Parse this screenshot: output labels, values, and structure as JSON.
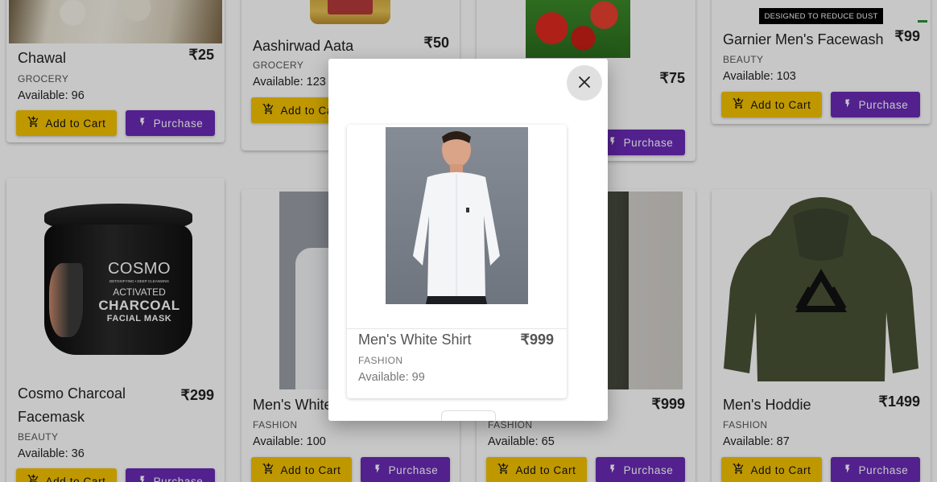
{
  "currency": "₹",
  "button_labels": {
    "cart": "Add to Cart",
    "buy": "Purchase"
  },
  "products": [
    {
      "name": "Chawal",
      "price": "₹25",
      "category": "GROCERY",
      "available": "Available: 96"
    },
    {
      "name": "Aashirwad Aata",
      "price": "₹50",
      "category": "GROCERY",
      "available": "Available: 123"
    },
    {
      "name": "",
      "price": "₹75",
      "category": "",
      "available": ""
    },
    {
      "name": "Garnier Men's Facewash",
      "price": "₹99",
      "category": "BEAUTY",
      "available": "Available: 103",
      "banner_text": "DESIGNED TO REDUCE DUST"
    },
    {
      "name": "Cosmo Charcoal Facemask",
      "price": "₹299",
      "category": "BEAUTY",
      "available": "Available: 36",
      "label_lines": [
        "COSMO",
        "DETOXIFYING • DEEP CLEANSING",
        "ACTIVATED",
        "CHARCOAL",
        "FACIAL MASK"
      ]
    },
    {
      "name": "Men's White Shirt",
      "price": "",
      "category": "FASHION",
      "available": "Available: 100"
    },
    {
      "name": "",
      "price": "₹999",
      "category": "FASHION",
      "available": "Available: 65"
    },
    {
      "name": "Men's Hoddie",
      "price": "₹1499",
      "category": "FASHION",
      "available": "Available: 87"
    }
  ],
  "modal": {
    "name": "Men's White Shirt",
    "price": "₹999",
    "category": "FASHION",
    "available": "Available: 99"
  },
  "colors": {
    "cart_button": "#f5c300",
    "purchase_button": "#6a2bb6",
    "overlay": "rgba(0,0,0,0.22)"
  },
  "icons": [
    "cart-icon",
    "bolt-icon",
    "close-icon"
  ]
}
